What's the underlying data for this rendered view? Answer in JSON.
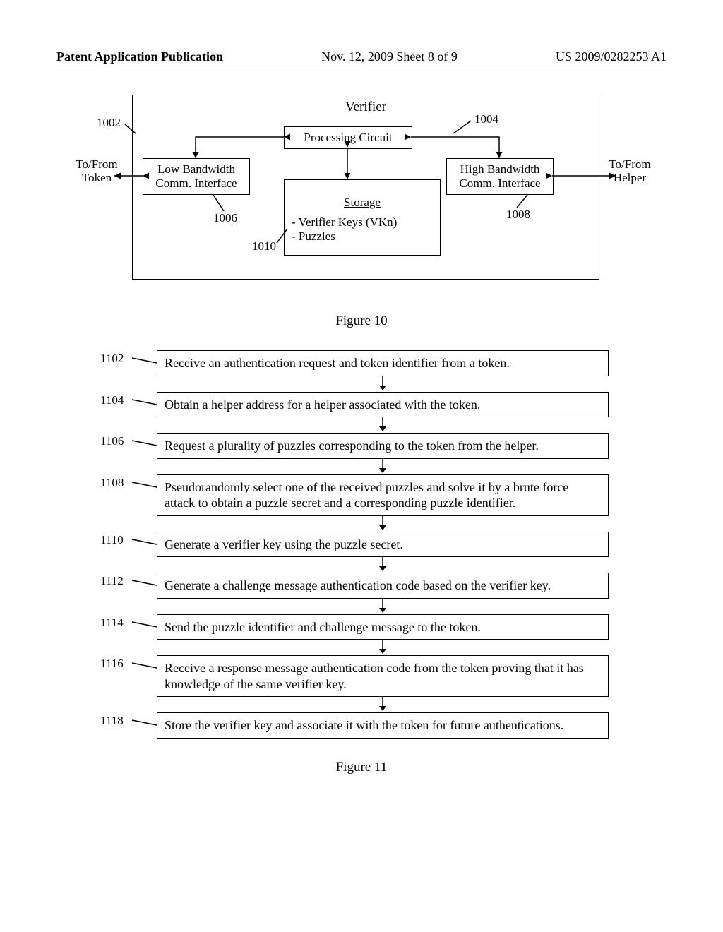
{
  "header": {
    "left": "Patent Application Publication",
    "center": "Nov. 12, 2009  Sheet 8 of 9",
    "right": "US 2009/0282253 A1"
  },
  "fig10": {
    "title": "Verifier",
    "processing": "Processing Circuit",
    "low_bw_l1": "Low Bandwidth",
    "low_bw_l2": "Comm. Interface",
    "high_bw_l1": "High Bandwidth",
    "high_bw_l2": "Comm. Interface",
    "storage_title": "Storage",
    "storage_item1": "- Verifier Keys (VKn)",
    "storage_item2": "- Puzzles",
    "side_left_l1": "To/From",
    "side_left_l2": "Token",
    "side_right_l1": "To/From",
    "side_right_l2": "Helper",
    "ref_1002": "1002",
    "ref_1004": "1004",
    "ref_1006": "1006",
    "ref_1008": "1008",
    "ref_1010": "1010",
    "caption": "Figure 10"
  },
  "fig11": {
    "steps": [
      {
        "ref": "1102",
        "text": "Receive an authentication request and token identifier from a token."
      },
      {
        "ref": "1104",
        "text": "Obtain a helper address for a helper associated with the token."
      },
      {
        "ref": "1106",
        "text": "Request a plurality of puzzles corresponding to the token from the helper."
      },
      {
        "ref": "1108",
        "text": "Pseudorandomly select one of the received puzzles and solve it by a brute force attack to obtain a puzzle secret and a corresponding puzzle identifier."
      },
      {
        "ref": "1110",
        "text": "Generate a verifier key using the puzzle secret."
      },
      {
        "ref": "1112",
        "text": "Generate a challenge message authentication code based on the verifier key."
      },
      {
        "ref": "1114",
        "text": "Send the puzzle identifier and challenge message to the token."
      },
      {
        "ref": "1116",
        "text": "Receive a response message authentication code from the token proving that it has knowledge of the same verifier key."
      },
      {
        "ref": "1118",
        "text": "Store the verifier key and associate it with the token for future authentications."
      }
    ],
    "caption": "Figure 11"
  }
}
